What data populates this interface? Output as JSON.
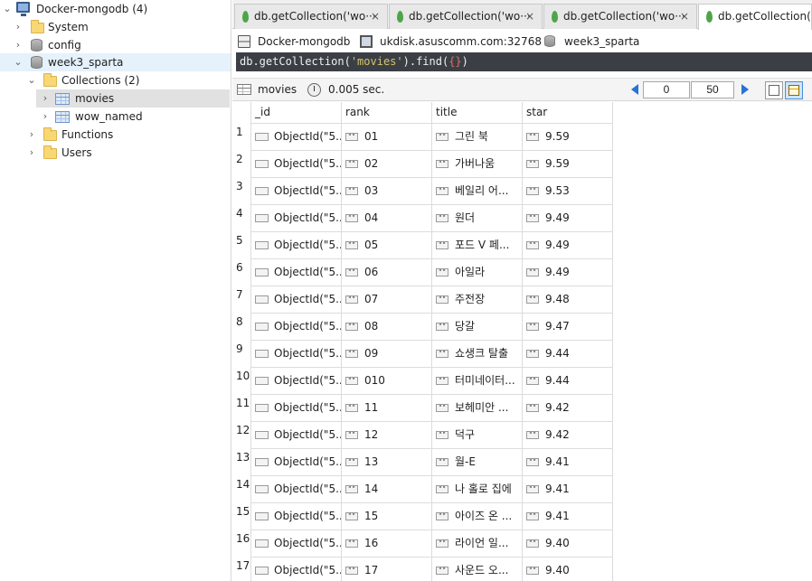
{
  "tree": {
    "connection": "Docker-mongodb (4)",
    "items": [
      {
        "label": "System"
      },
      {
        "label": "config"
      },
      {
        "label": "week3_sparta"
      },
      {
        "label": "Collections (2)"
      },
      {
        "label": "movies"
      },
      {
        "label": "wow_named"
      },
      {
        "label": "Functions"
      },
      {
        "label": "Users"
      }
    ]
  },
  "tabs": [
    {
      "label": "db.getCollection('wo···",
      "close": "×"
    },
    {
      "label": "db.getCollection('wo···",
      "close": "×"
    },
    {
      "label": "db.getCollection('wo···",
      "close": "×"
    },
    {
      "label": "db.getCollection('m",
      "close": ""
    }
  ],
  "connbar": {
    "server": "Docker-mongodb",
    "host": "ukdisk.asuscomm.com:32768",
    "database": "week3_sparta"
  },
  "query": {
    "part1": "db.getCollection(",
    "part2": "'movies'",
    "part3": ").find(",
    "part4": "{}",
    "part5": ")"
  },
  "result": {
    "collection": "movies",
    "time": "0.005 sec.",
    "page_start": "0",
    "page_size": "50"
  },
  "columns": [
    "_id",
    "rank",
    "title",
    "star"
  ],
  "rows": [
    {
      "n": "1",
      "id": "ObjectId(\"5...",
      "rank": "01",
      "title": "그린 북",
      "star": "9.59"
    },
    {
      "n": "2",
      "id": "ObjectId(\"5...",
      "rank": "02",
      "title": "가버나움",
      "star": "9.59"
    },
    {
      "n": "3",
      "id": "ObjectId(\"5...",
      "rank": "03",
      "title": "베일리 어...",
      "star": "9.53"
    },
    {
      "n": "4",
      "id": "ObjectId(\"5...",
      "rank": "04",
      "title": "원더",
      "star": "9.49"
    },
    {
      "n": "5",
      "id": "ObjectId(\"5...",
      "rank": "05",
      "title": "포드 V 페...",
      "star": "9.49"
    },
    {
      "n": "6",
      "id": "ObjectId(\"5...",
      "rank": "06",
      "title": "아일라",
      "star": "9.49"
    },
    {
      "n": "7",
      "id": "ObjectId(\"5...",
      "rank": "07",
      "title": "주전장",
      "star": "9.48"
    },
    {
      "n": "8",
      "id": "ObjectId(\"5...",
      "rank": "08",
      "title": "당갈",
      "star": "9.47"
    },
    {
      "n": "9",
      "id": "ObjectId(\"5...",
      "rank": "09",
      "title": "쇼생크 탈출",
      "star": "9.44"
    },
    {
      "n": "10",
      "id": "ObjectId(\"5...",
      "rank": "010",
      "title": "터미네이터...",
      "star": "9.44"
    },
    {
      "n": "11",
      "id": "ObjectId(\"5...",
      "rank": "11",
      "title": "보헤미안 ...",
      "star": "9.42"
    },
    {
      "n": "12",
      "id": "ObjectId(\"5...",
      "rank": "12",
      "title": "덕구",
      "star": "9.42"
    },
    {
      "n": "13",
      "id": "ObjectId(\"5...",
      "rank": "13",
      "title": "월-E",
      "star": "9.41"
    },
    {
      "n": "14",
      "id": "ObjectId(\"5...",
      "rank": "14",
      "title": "나 홀로 집에",
      "star": "9.41"
    },
    {
      "n": "15",
      "id": "ObjectId(\"5...",
      "rank": "15",
      "title": "아이즈 온 ...",
      "star": "9.41"
    },
    {
      "n": "16",
      "id": "ObjectId(\"5...",
      "rank": "16",
      "title": "라이언 일...",
      "star": "9.40"
    },
    {
      "n": "17",
      "id": "ObjectId(\"5...",
      "rank": "17",
      "title": "사운드 오...",
      "star": "9.40"
    }
  ],
  "str_badge": "\"\""
}
